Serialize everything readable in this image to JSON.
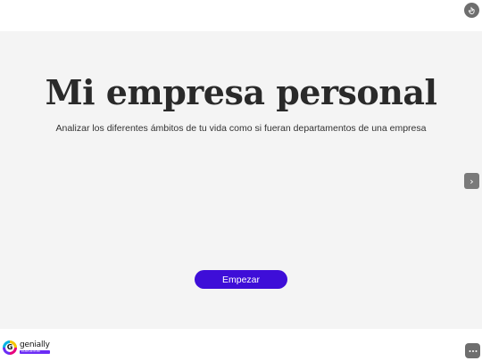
{
  "title": "Mi empresa personal",
  "subtitle": "Analizar los diferentes ámbitos de tu vida como si fueran departamentos de una empresa",
  "start_button": {
    "label": "Empezar"
  },
  "next_button": {
    "glyph": "›",
    "icon": "chevron-right-icon"
  },
  "fullscreen_button": {
    "icon": "hand-pointer-icon"
  },
  "more_button": {
    "icon": "more-dots-icon"
  },
  "brand": {
    "name": "genially",
    "mark_letter": "G",
    "badge": "EDUCATION"
  },
  "colors": {
    "accent": "#3e0ed8",
    "stage_background": "#f4f4f4",
    "title": "#2a2a2a",
    "control_gray": "#6e6e6e"
  }
}
